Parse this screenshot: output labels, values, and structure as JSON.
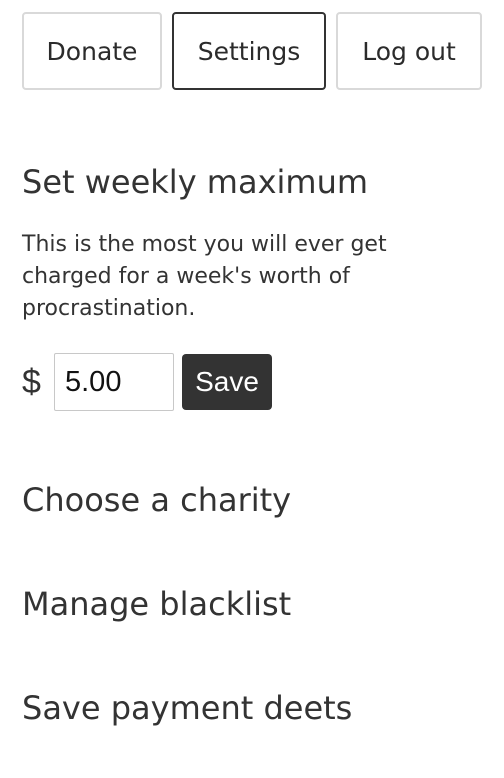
{
  "nav": {
    "donate_label": "Donate",
    "settings_label": "Settings",
    "logout_label": "Log out",
    "active": "Settings"
  },
  "weekly_max": {
    "title": "Set weekly maximum",
    "description": "This is the most you will ever get charged for a week's worth of procrastination.",
    "currency_symbol": "$",
    "amount_value": "5.00",
    "save_label": "Save"
  },
  "sections": {
    "charity_title": "Choose a charity",
    "blacklist_title": "Manage blacklist",
    "payment_title": "Save payment deets"
  },
  "colors": {
    "text": "#333333",
    "button_border": "#d9d9d9",
    "active_border": "#333333",
    "save_button_bg": "#333333"
  }
}
